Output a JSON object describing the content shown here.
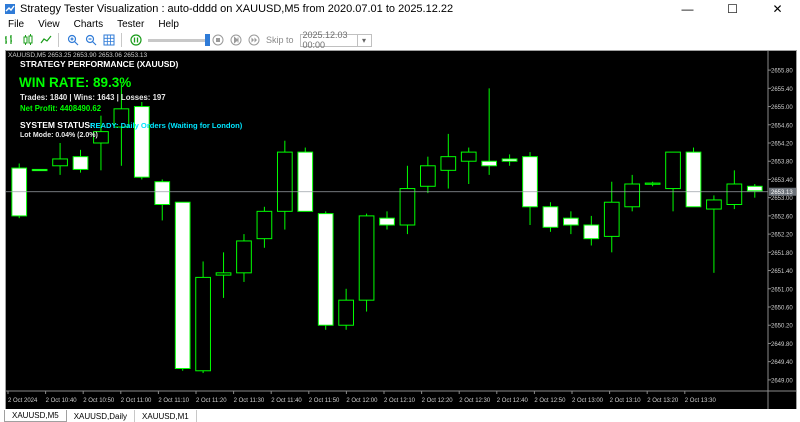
{
  "window": {
    "title": "Strategy Tester Visualization : auto-dddd on XAUUSD,M5 from 2020.07.01 to 2025.12.22",
    "minimize": "—",
    "maximize": "☐",
    "close": "✕"
  },
  "menu": [
    "File",
    "View",
    "Charts",
    "Tester",
    "Help"
  ],
  "toolbar": {
    "skip_label": "Skip to",
    "skip_date": "2025.12.03 00:00",
    "calendar": "▾"
  },
  "chart": {
    "header": "XAUUSD,M5  2653.25 2653.90 2653.06 2653.13",
    "current_price": "2653.13",
    "colors": {
      "background": "#000000",
      "candle": "#00ff00",
      "bull_body": "#000000",
      "bear_body": "#ffffff",
      "price_line": "#9aa0a6"
    }
  },
  "overlay": {
    "header": "STRATEGY PERFORMANCE (XAUUSD)",
    "win_rate": "WIN RATE: 89.3%",
    "trades": "Trades: 1840 | Wins: 1643 | Losses: 197",
    "net_profit": "Net Profit: 4408490.62",
    "system_status": "SYSTEM STATUS:",
    "status_value": "READY: Daily Orders (Waiting for London)",
    "lot_mode": "Lot Mode: 0.04% (2.0%)"
  },
  "tabs": [
    {
      "label": "XAUUSD,M5",
      "active": true
    },
    {
      "label": "XAUUSD,Daily",
      "active": false
    },
    {
      "label": "XAUUSD,M1",
      "active": false
    }
  ],
  "chart_data": {
    "type": "candlestick",
    "y_axis_labels": [
      "2655.80",
      "2655.40",
      "2655.00",
      "2654.60",
      "2654.20",
      "2653.80",
      "2653.40",
      "2653.00",
      "2652.60",
      "2652.20",
      "2651.80",
      "2651.40",
      "2651.00",
      "2650.60",
      "2650.20",
      "2649.80",
      "2649.40",
      "2649.00"
    ],
    "x_axis_labels": [
      "2 Oct 2024",
      "2 Oct 10:40",
      "2 Oct 10:50",
      "2 Oct 11:00",
      "2 Oct 11:10",
      "2 Oct 11:20",
      "2 Oct 11:30",
      "2 Oct 11:40",
      "2 Oct 11:50",
      "2 Oct 12:00",
      "2 Oct 12:10",
      "2 Oct 12:20",
      "2 Oct 12:30",
      "2 Oct 12:40",
      "2 Oct 12:50",
      "2 Oct 13:00",
      "2 Oct 13:10",
      "2 Oct 13:20",
      "2 Oct 13:30"
    ],
    "y_range": [
      2648.8,
      2656.0
    ],
    "candles": [
      {
        "o": 2653.65,
        "h": 2653.75,
        "l": 2652.55,
        "c": 2652.6
      },
      {
        "o": 2653.62,
        "h": 2653.62,
        "l": 2653.62,
        "c": 2653.6
      },
      {
        "o": 2653.7,
        "h": 2654.2,
        "l": 2653.5,
        "c": 2653.85
      },
      {
        "o": 2653.9,
        "h": 2654.05,
        "l": 2653.55,
        "c": 2653.62
      },
      {
        "o": 2654.2,
        "h": 2654.8,
        "l": 2653.6,
        "c": 2654.45
      },
      {
        "o": 2654.55,
        "h": 2655.5,
        "l": 2653.7,
        "c": 2654.95
      },
      {
        "o": 2655.0,
        "h": 2655.1,
        "l": 2653.4,
        "c": 2653.45
      },
      {
        "o": 2653.35,
        "h": 2653.4,
        "l": 2652.5,
        "c": 2652.85
      },
      {
        "o": 2652.9,
        "h": 2652.9,
        "l": 2649.2,
        "c": 2649.25
      },
      {
        "o": 2649.2,
        "h": 2651.6,
        "l": 2649.15,
        "c": 2651.25
      },
      {
        "o": 2651.3,
        "h": 2651.8,
        "l": 2650.8,
        "c": 2651.35
      },
      {
        "o": 2651.35,
        "h": 2652.2,
        "l": 2651.15,
        "c": 2652.05
      },
      {
        "o": 2652.1,
        "h": 2652.8,
        "l": 2651.9,
        "c": 2652.7
      },
      {
        "o": 2652.7,
        "h": 2654.25,
        "l": 2652.3,
        "c": 2654.0
      },
      {
        "o": 2654.0,
        "h": 2654.1,
        "l": 2652.7,
        "c": 2652.7
      },
      {
        "o": 2652.65,
        "h": 2652.7,
        "l": 2650.1,
        "c": 2650.2
      },
      {
        "o": 2650.2,
        "h": 2651.0,
        "l": 2650.1,
        "c": 2650.75
      },
      {
        "o": 2650.75,
        "h": 2652.65,
        "l": 2650.5,
        "c": 2652.6
      },
      {
        "o": 2652.55,
        "h": 2652.7,
        "l": 2652.3,
        "c": 2652.4
      },
      {
        "o": 2652.4,
        "h": 2653.7,
        "l": 2652.2,
        "c": 2653.2
      },
      {
        "o": 2653.25,
        "h": 2653.9,
        "l": 2653.1,
        "c": 2653.7
      },
      {
        "o": 2653.6,
        "h": 2654.4,
        "l": 2653.2,
        "c": 2653.9
      },
      {
        "o": 2653.8,
        "h": 2654.1,
        "l": 2653.3,
        "c": 2654.0
      },
      {
        "o": 2653.8,
        "h": 2655.4,
        "l": 2653.5,
        "c": 2653.7
      },
      {
        "o": 2653.85,
        "h": 2653.95,
        "l": 2653.7,
        "c": 2653.8
      },
      {
        "o": 2653.9,
        "h": 2654.0,
        "l": 2652.4,
        "c": 2652.8
      },
      {
        "o": 2652.8,
        "h": 2652.9,
        "l": 2652.25,
        "c": 2652.35
      },
      {
        "o": 2652.55,
        "h": 2652.7,
        "l": 2652.2,
        "c": 2652.4
      },
      {
        "o": 2652.4,
        "h": 2652.6,
        "l": 2651.95,
        "c": 2652.1
      },
      {
        "o": 2652.15,
        "h": 2653.35,
        "l": 2651.8,
        "c": 2652.9
      },
      {
        "o": 2652.8,
        "h": 2653.5,
        "l": 2652.7,
        "c": 2653.3
      },
      {
        "o": 2653.3,
        "h": 2653.35,
        "l": 2653.25,
        "c": 2653.32
      },
      {
        "o": 2653.2,
        "h": 2654.0,
        "l": 2652.7,
        "c": 2654.0
      },
      {
        "o": 2654.0,
        "h": 2654.1,
        "l": 2652.8,
        "c": 2652.8
      },
      {
        "o": 2652.75,
        "h": 2653.05,
        "l": 2651.35,
        "c": 2652.95
      },
      {
        "o": 2652.85,
        "h": 2653.6,
        "l": 2652.75,
        "c": 2653.3
      },
      {
        "o": 2653.25,
        "h": 2653.3,
        "l": 2653.0,
        "c": 2653.15
      }
    ]
  }
}
